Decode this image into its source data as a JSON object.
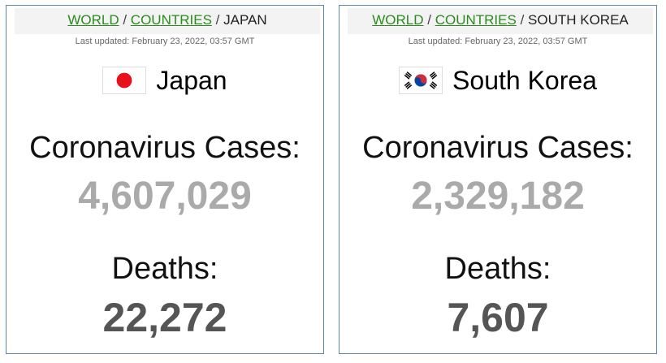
{
  "panels": [
    {
      "breadcrumb": {
        "world": "WORLD",
        "countries": "COUNTRIES",
        "current": "JAPAN",
        "separator": "/"
      },
      "last_updated": "Last updated: February 23, 2022, 03:57 GMT",
      "country": "Japan",
      "flag_icon": "japan-flag-icon",
      "cases_label": "Coronavirus Cases:",
      "cases": "4,607,029",
      "deaths_label": "Deaths:",
      "deaths": "22,272"
    },
    {
      "breadcrumb": {
        "world": "WORLD",
        "countries": "COUNTRIES",
        "current": "SOUTH KOREA",
        "separator": "/"
      },
      "last_updated": "Last updated: February 23, 2022, 03:57 GMT",
      "country": "South Korea",
      "flag_icon": "south-korea-flag-icon",
      "cases_label": "Coronavirus Cases:",
      "cases": "2,329,182",
      "deaths_label": "Deaths:",
      "deaths": "7,607"
    }
  ],
  "colors": {
    "link": "#2b8a1e",
    "border": "#5a86b8",
    "cases_number": "#aaaaaa",
    "deaths_number": "#555555",
    "japan_red": "#e8101c",
    "korea_red": "#cd2e3a",
    "korea_blue": "#0047a0"
  }
}
